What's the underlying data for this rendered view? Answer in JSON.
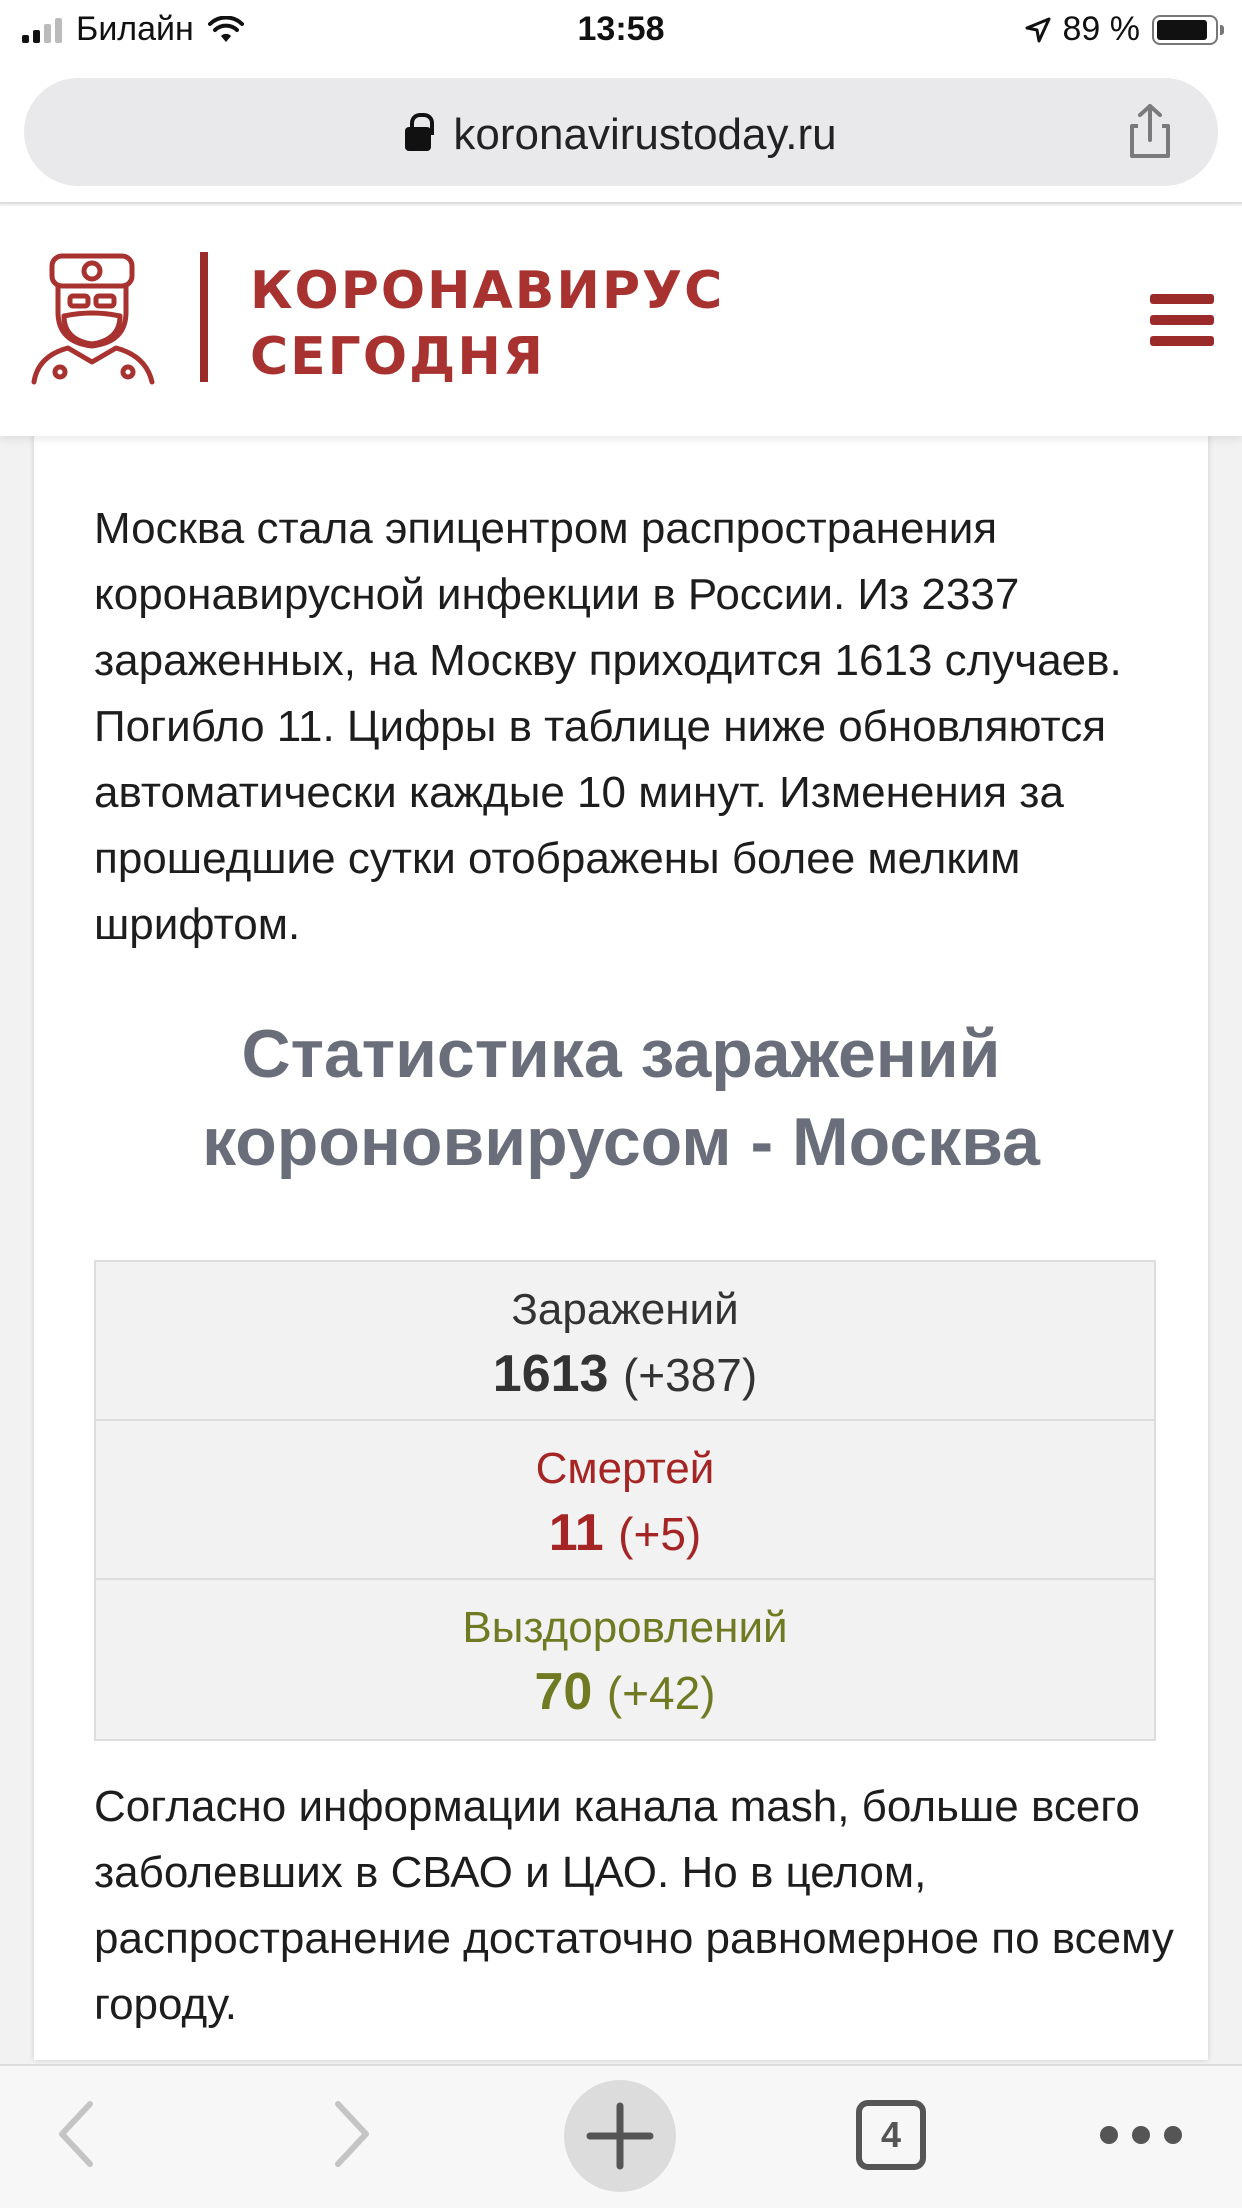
{
  "status_bar": {
    "carrier": "Билайн",
    "time": "13:58",
    "battery_percent": "89 %",
    "battery_level": 0.89
  },
  "browser": {
    "url": "koronavirustoday.ru",
    "icons": [
      "lock-icon",
      "share-icon"
    ],
    "toolbar": {
      "tabs_count": "4",
      "icons": [
        "back-icon",
        "forward-icon",
        "new-tab-icon",
        "tabs-icon",
        "more-icon"
      ]
    }
  },
  "site": {
    "logo_line1": "КОРОНАВИРУС",
    "logo_line2": "СЕГОДНЯ",
    "brand_color": "#a8322f"
  },
  "article": {
    "intro": "Москва стала эпицентром распространения коронавирусной инфекции в России. Из 2337 зараженных, на Москву приходится 1613 случаев. Погибло 11.  Цифры в таблице ниже обновляются автоматически каждые 10 минут. Изменения за прошедшие сутки отображены более мелким шрифтом.",
    "stats_title": "Статистика заражений короновирусом - Москва",
    "stats": [
      {
        "label": "Заражений",
        "value": "1613",
        "delta": "(+387)",
        "color": "#333333"
      },
      {
        "label": "Смертей",
        "value": "11",
        "delta": "(+5)",
        "color": "#a52525"
      },
      {
        "label": "Выздоровлений",
        "value": "70",
        "delta": "(+42)",
        "color": "#6f7a22"
      }
    ],
    "outro": "Согласно информации канала mash, больше всего заболевших в СВАО и ЦАО. Но в целом, распространение достаточно равномерное по всему городу."
  }
}
